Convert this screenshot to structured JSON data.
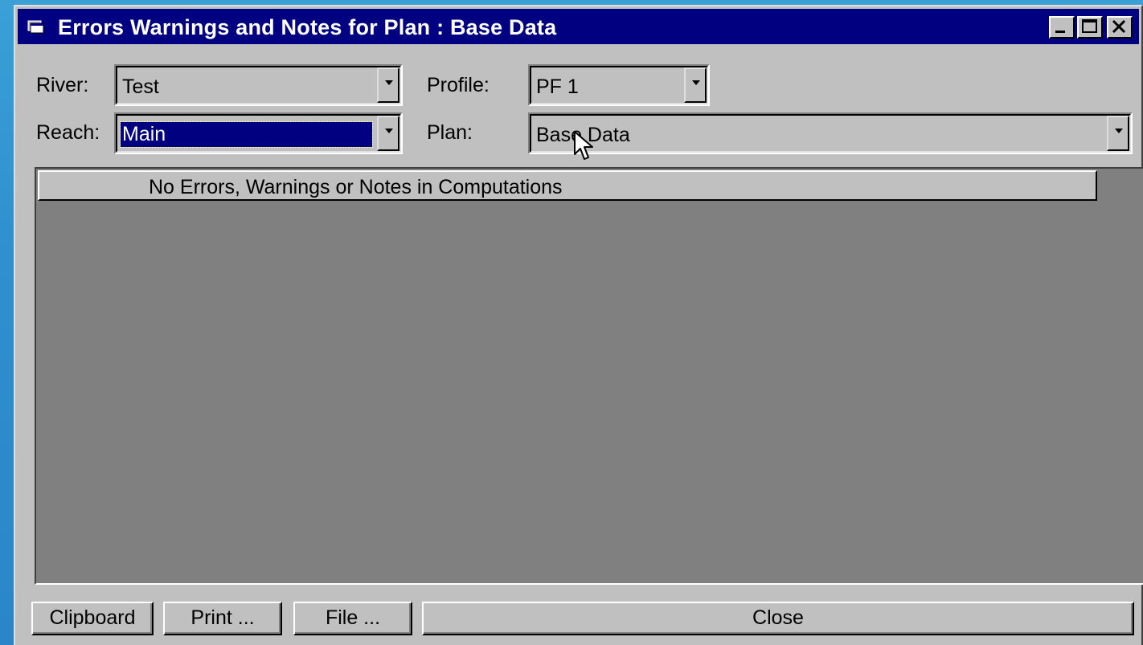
{
  "window": {
    "title": "Errors Warnings and Notes for Plan : Base Data",
    "icon": "app-window-icon",
    "controls": [
      "minimize-icon",
      "maximize-icon",
      "close-icon"
    ]
  },
  "filters": {
    "river": {
      "label": "River:",
      "value": "Test"
    },
    "reach": {
      "label": "Reach:",
      "value": "Main"
    },
    "profile": {
      "label": "Profile:",
      "value": "PF 1"
    },
    "plan": {
      "label": "Plan:",
      "value": "Base Data"
    }
  },
  "messages": {
    "header": "No Errors, Warnings or Notes in Computations"
  },
  "buttons": {
    "clipboard": "Clipboard",
    "print": "Print ...",
    "file": "File ...",
    "close": "Close"
  },
  "colors": {
    "titlebar": "#000080",
    "face": "#c0c0c0",
    "grid_background": "#808080",
    "desktop": "#2f8fcf"
  }
}
